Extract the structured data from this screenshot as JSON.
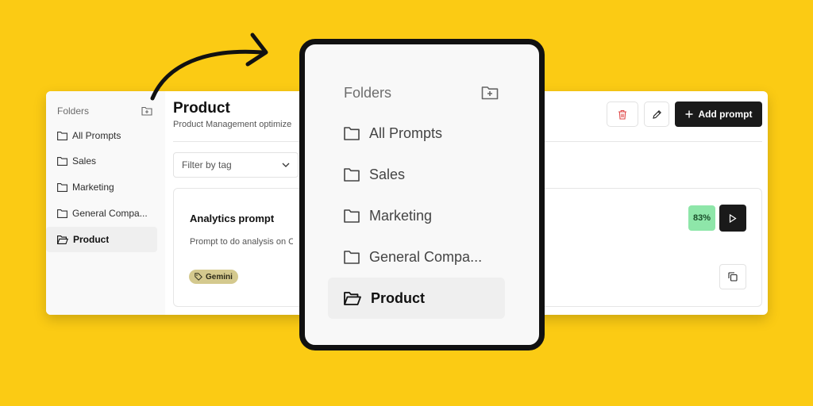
{
  "sidebar": {
    "header": "Folders",
    "items": [
      {
        "label": "All Prompts"
      },
      {
        "label": "Sales"
      },
      {
        "label": "Marketing"
      },
      {
        "label": "General Compa..."
      },
      {
        "label": "Product"
      }
    ],
    "active": "Product"
  },
  "main": {
    "title": "Product",
    "subtitle": "Product Management optimize",
    "add_prompt_label": "Add prompt",
    "filter_placeholder": "Filter by tag"
  },
  "card": {
    "title": "Analytics prompt",
    "description": "Prompt to do analysis on C",
    "tag": "Gemini",
    "score": "83%"
  },
  "zoom": {
    "header": "Folders",
    "items": [
      {
        "label": "All Prompts"
      },
      {
        "label": "Sales"
      },
      {
        "label": "Marketing"
      },
      {
        "label": "General Compa..."
      },
      {
        "label": "Product"
      }
    ]
  },
  "colors": {
    "background": "#FBCB14",
    "button_dark": "#1a1a1a",
    "score_bg": "#8ee6a9",
    "tag_bg": "#d4c98e",
    "delete_red": "#e04848"
  }
}
